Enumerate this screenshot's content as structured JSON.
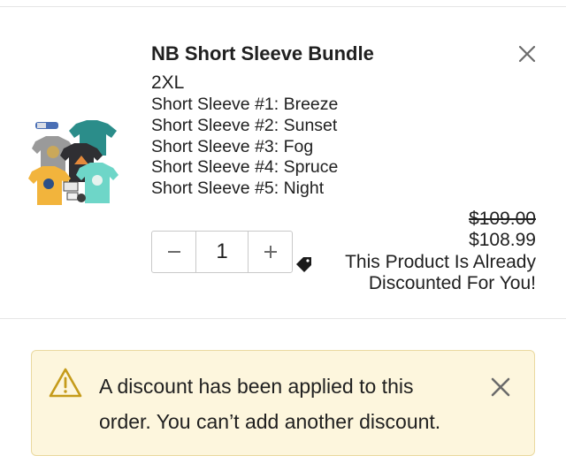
{
  "item": {
    "title": "NB Short Sleeve Bundle",
    "variant": "2XL",
    "options": [
      "Short Sleeve #1: Breeze",
      "Short Sleeve #2: Sunset",
      "Short Sleeve #3: Fog",
      "Short Sleeve #4: Spruce",
      "Short Sleeve #5: Night"
    ],
    "quantity": "1",
    "minus_symbol": "−",
    "plus_symbol": "+",
    "original_price": "$109.00",
    "price": "$108.99",
    "discount_note": "This Product Is Already Discounted For You!"
  },
  "alert": {
    "message": "A discount has been applied to this order. You can’t add another discount."
  },
  "icons": {
    "remove": "close-icon",
    "tag": "tag-icon",
    "warning": "warning-icon",
    "dismiss": "close-icon"
  },
  "colors": {
    "alert_background": "#fdf6dd",
    "alert_border": "#ead9a0",
    "warning_icon": "#c59b1a"
  }
}
